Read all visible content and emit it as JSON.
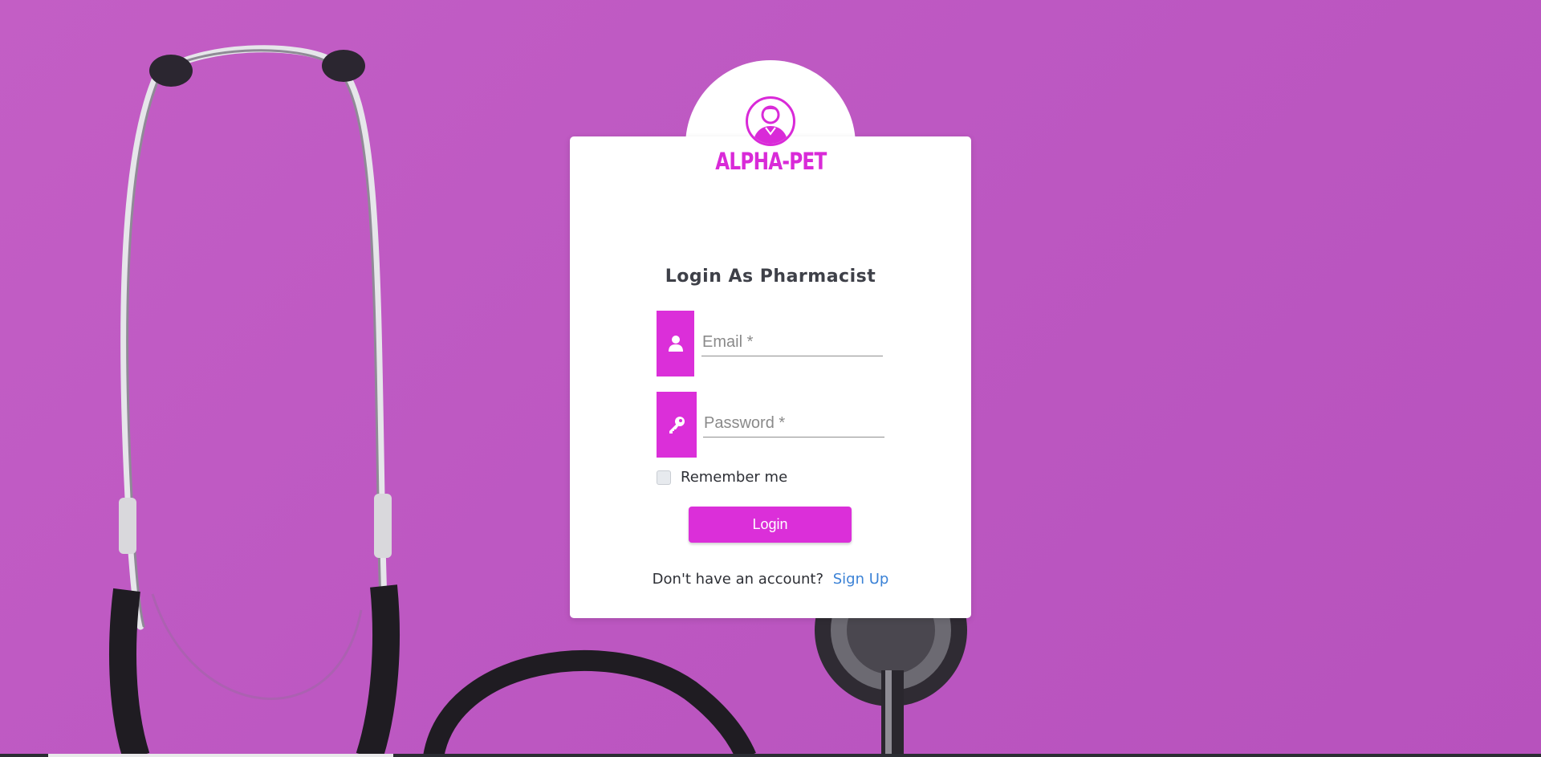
{
  "brand": {
    "name": "ALPHA-PET",
    "color": "#d92ad8"
  },
  "form": {
    "title": "Login As Pharmacist",
    "email_placeholder": "Email *",
    "password_placeholder": "Password *",
    "remember_label": "Remember me",
    "remember_checked": false,
    "login_label": "Login"
  },
  "footer": {
    "prompt": "Don't have an account?",
    "signup_label": "Sign Up"
  },
  "icons": {
    "email": "user-icon",
    "password": "key-icon",
    "logo": "doctor-avatar-icon",
    "background": "stethoscope"
  },
  "colors": {
    "background": "#c15bc3",
    "accent": "#db2fd9",
    "link": "#3b82d6"
  }
}
